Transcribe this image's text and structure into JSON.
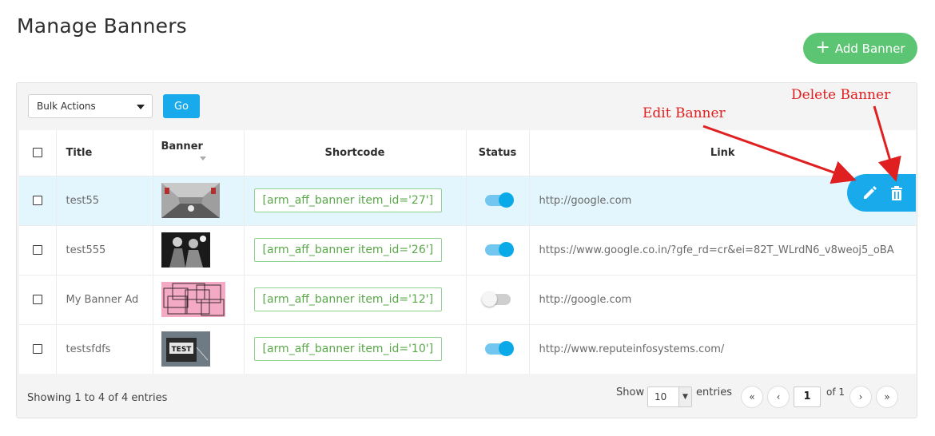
{
  "page": {
    "title": "Manage Banners"
  },
  "toolbar": {
    "add_label": "Add Banner",
    "bulk_label": "Bulk Actions",
    "go_label": "Go"
  },
  "table": {
    "headers": {
      "title": "Title",
      "banner": "Banner",
      "shortcode": "Shortcode",
      "status": "Status",
      "link": "Link"
    },
    "rows": [
      {
        "title": "test55",
        "shortcode": "[arm_aff_banner item_id='27']",
        "status": true,
        "link": "http://google.com",
        "thumb": "tunnel"
      },
      {
        "title": "test555",
        "shortcode": "[arm_aff_banner item_id='26']",
        "status": true,
        "link": "https://www.google.co.in/?gfe_rd=cr&ei=82T_WLrdN6_v8weoj5_oBA",
        "thumb": "figures"
      },
      {
        "title": "My Banner Ad",
        "shortcode": "[arm_aff_banner item_id='12']",
        "status": false,
        "link": "http://google.com",
        "thumb": "pink-boxes"
      },
      {
        "title": "testsfdfs",
        "shortcode": "[arm_aff_banner item_id='10']",
        "status": true,
        "link": "http://www.reputeinfosystems.com/",
        "thumb": "test-sign"
      }
    ]
  },
  "footer": {
    "showing": "Showing 1 to 4 of 4 entries",
    "show_label": "Show",
    "page_size": "10",
    "entries_label": "entries",
    "page": "1",
    "of_label": "of 1"
  },
  "annotations": {
    "edit": "Edit Banner",
    "delete": "Delete Banner"
  },
  "colors": {
    "accent": "#19aaec",
    "add": "#5cc574",
    "annotation": "#e02020",
    "shortcode": "#5aa84a"
  }
}
